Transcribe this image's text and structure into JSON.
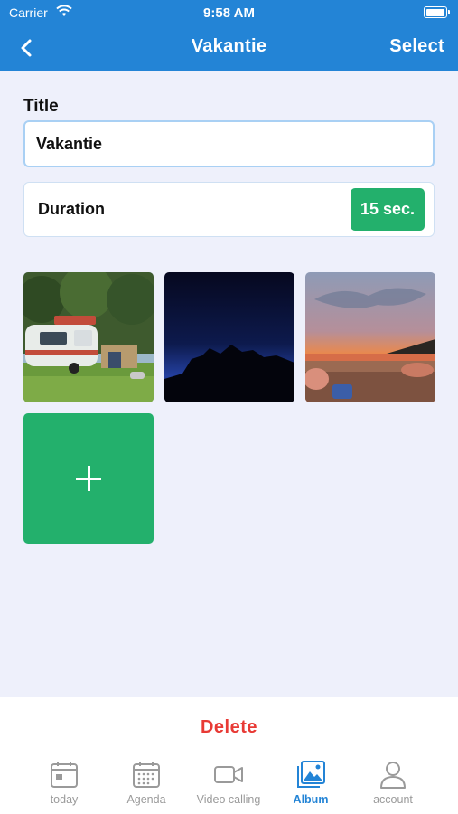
{
  "status_bar": {
    "carrier": "Carrier",
    "time": "9:58 AM"
  },
  "nav": {
    "back_icon": "chevron-left-icon",
    "title": "Vakantie",
    "select_label": "Select"
  },
  "form": {
    "title_label": "Title",
    "title_value": "Vakantie",
    "duration_label": "Duration",
    "duration_value": "15 sec."
  },
  "photos": [
    {
      "description": "caravan-photo"
    },
    {
      "description": "night-sky-photo"
    },
    {
      "description": "sunset-beach-photo"
    }
  ],
  "add_photo_icon": "plus-icon",
  "delete_label": "Delete",
  "tabs": [
    {
      "label": "today",
      "icon": "calendar-day-icon",
      "active": false
    },
    {
      "label": "Agenda",
      "icon": "calendar-grid-icon",
      "active": false
    },
    {
      "label": "Video calling",
      "icon": "video-camera-icon",
      "active": false
    },
    {
      "label": "Album",
      "icon": "photo-album-icon",
      "active": true
    },
    {
      "label": "account",
      "icon": "person-icon",
      "active": false
    }
  ],
  "colors": {
    "header": "#2384d6",
    "background": "#eef0fb",
    "accent_green": "#23b06c",
    "delete_red": "#e83a35",
    "active_tab": "#2384d6",
    "inactive_tab": "#9a9a9a"
  }
}
